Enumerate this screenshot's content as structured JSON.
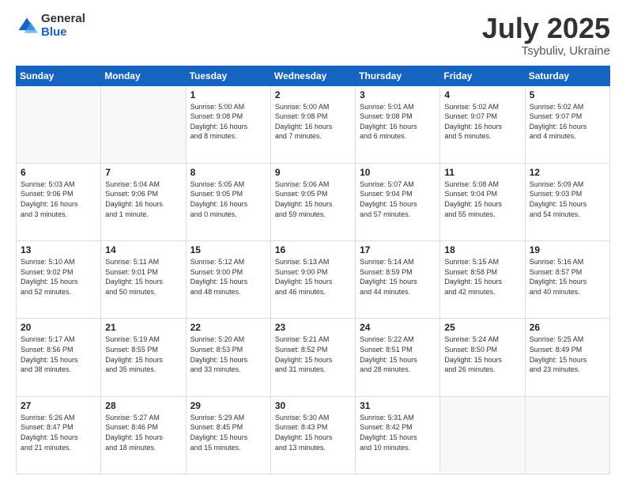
{
  "logo": {
    "general": "General",
    "blue": "Blue"
  },
  "header": {
    "title": "July 2025",
    "subtitle": "Tsybuliv, Ukraine"
  },
  "weekdays": [
    "Sunday",
    "Monday",
    "Tuesday",
    "Wednesday",
    "Thursday",
    "Friday",
    "Saturday"
  ],
  "weeks": [
    [
      {
        "day": "",
        "info": ""
      },
      {
        "day": "",
        "info": ""
      },
      {
        "day": "1",
        "info": "Sunrise: 5:00 AM\nSunset: 9:08 PM\nDaylight: 16 hours\nand 8 minutes."
      },
      {
        "day": "2",
        "info": "Sunrise: 5:00 AM\nSunset: 9:08 PM\nDaylight: 16 hours\nand 7 minutes."
      },
      {
        "day": "3",
        "info": "Sunrise: 5:01 AM\nSunset: 9:08 PM\nDaylight: 16 hours\nand 6 minutes."
      },
      {
        "day": "4",
        "info": "Sunrise: 5:02 AM\nSunset: 9:07 PM\nDaylight: 16 hours\nand 5 minutes."
      },
      {
        "day": "5",
        "info": "Sunrise: 5:02 AM\nSunset: 9:07 PM\nDaylight: 16 hours\nand 4 minutes."
      }
    ],
    [
      {
        "day": "6",
        "info": "Sunrise: 5:03 AM\nSunset: 9:06 PM\nDaylight: 16 hours\nand 3 minutes."
      },
      {
        "day": "7",
        "info": "Sunrise: 5:04 AM\nSunset: 9:06 PM\nDaylight: 16 hours\nand 1 minute."
      },
      {
        "day": "8",
        "info": "Sunrise: 5:05 AM\nSunset: 9:05 PM\nDaylight: 16 hours\nand 0 minutes."
      },
      {
        "day": "9",
        "info": "Sunrise: 5:06 AM\nSunset: 9:05 PM\nDaylight: 15 hours\nand 59 minutes."
      },
      {
        "day": "10",
        "info": "Sunrise: 5:07 AM\nSunset: 9:04 PM\nDaylight: 15 hours\nand 57 minutes."
      },
      {
        "day": "11",
        "info": "Sunrise: 5:08 AM\nSunset: 9:04 PM\nDaylight: 15 hours\nand 55 minutes."
      },
      {
        "day": "12",
        "info": "Sunrise: 5:09 AM\nSunset: 9:03 PM\nDaylight: 15 hours\nand 54 minutes."
      }
    ],
    [
      {
        "day": "13",
        "info": "Sunrise: 5:10 AM\nSunset: 9:02 PM\nDaylight: 15 hours\nand 52 minutes."
      },
      {
        "day": "14",
        "info": "Sunrise: 5:11 AM\nSunset: 9:01 PM\nDaylight: 15 hours\nand 50 minutes."
      },
      {
        "day": "15",
        "info": "Sunrise: 5:12 AM\nSunset: 9:00 PM\nDaylight: 15 hours\nand 48 minutes."
      },
      {
        "day": "16",
        "info": "Sunrise: 5:13 AM\nSunset: 9:00 PM\nDaylight: 15 hours\nand 46 minutes."
      },
      {
        "day": "17",
        "info": "Sunrise: 5:14 AM\nSunset: 8:59 PM\nDaylight: 15 hours\nand 44 minutes."
      },
      {
        "day": "18",
        "info": "Sunrise: 5:15 AM\nSunset: 8:58 PM\nDaylight: 15 hours\nand 42 minutes."
      },
      {
        "day": "19",
        "info": "Sunrise: 5:16 AM\nSunset: 8:57 PM\nDaylight: 15 hours\nand 40 minutes."
      }
    ],
    [
      {
        "day": "20",
        "info": "Sunrise: 5:17 AM\nSunset: 8:56 PM\nDaylight: 15 hours\nand 38 minutes."
      },
      {
        "day": "21",
        "info": "Sunrise: 5:19 AM\nSunset: 8:55 PM\nDaylight: 15 hours\nand 35 minutes."
      },
      {
        "day": "22",
        "info": "Sunrise: 5:20 AM\nSunset: 8:53 PM\nDaylight: 15 hours\nand 33 minutes."
      },
      {
        "day": "23",
        "info": "Sunrise: 5:21 AM\nSunset: 8:52 PM\nDaylight: 15 hours\nand 31 minutes."
      },
      {
        "day": "24",
        "info": "Sunrise: 5:22 AM\nSunset: 8:51 PM\nDaylight: 15 hours\nand 28 minutes."
      },
      {
        "day": "25",
        "info": "Sunrise: 5:24 AM\nSunset: 8:50 PM\nDaylight: 15 hours\nand 26 minutes."
      },
      {
        "day": "26",
        "info": "Sunrise: 5:25 AM\nSunset: 8:49 PM\nDaylight: 15 hours\nand 23 minutes."
      }
    ],
    [
      {
        "day": "27",
        "info": "Sunrise: 5:26 AM\nSunset: 8:47 PM\nDaylight: 15 hours\nand 21 minutes."
      },
      {
        "day": "28",
        "info": "Sunrise: 5:27 AM\nSunset: 8:46 PM\nDaylight: 15 hours\nand 18 minutes."
      },
      {
        "day": "29",
        "info": "Sunrise: 5:29 AM\nSunset: 8:45 PM\nDaylight: 15 hours\nand 15 minutes."
      },
      {
        "day": "30",
        "info": "Sunrise: 5:30 AM\nSunset: 8:43 PM\nDaylight: 15 hours\nand 13 minutes."
      },
      {
        "day": "31",
        "info": "Sunrise: 5:31 AM\nSunset: 8:42 PM\nDaylight: 15 hours\nand 10 minutes."
      },
      {
        "day": "",
        "info": ""
      },
      {
        "day": "",
        "info": ""
      }
    ]
  ]
}
